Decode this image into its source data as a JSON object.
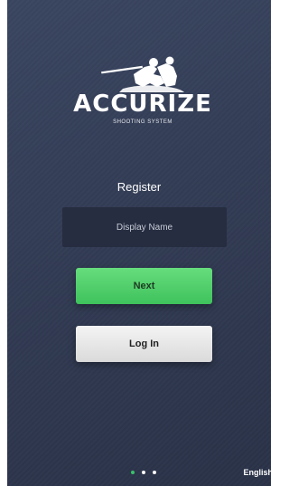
{
  "brand": {
    "name": "ACCURIZE",
    "tagline": "SHOOTING SYSTEM",
    "logo_icon": "hunter-silhouette-icon"
  },
  "register": {
    "heading": "Register",
    "display_name_placeholder": "Display Name",
    "display_name_value": ""
  },
  "buttons": {
    "next_label": "Next",
    "login_label": "Log In"
  },
  "pagination": {
    "total": 3,
    "active_index": 0
  },
  "language": {
    "label": "English"
  },
  "colors": {
    "background": "#323c54",
    "input_background": "#262d40",
    "next_button": "#4ccf68",
    "login_button": "#e8e8e8",
    "active_dot": "#38c26a"
  }
}
